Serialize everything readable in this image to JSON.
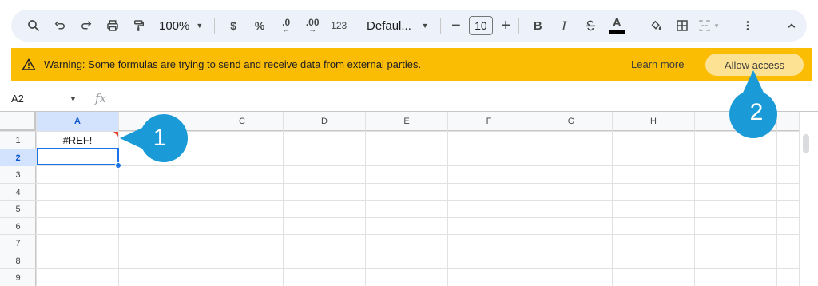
{
  "toolbar": {
    "zoom": "100%",
    "percent": "%",
    "currency": "$",
    "decrease_decimal": ".0",
    "increase_decimal": ".00",
    "number_format": "123",
    "font": "Defaul...",
    "font_size": "10",
    "minus": "−",
    "plus": "+",
    "bold": "B",
    "italic": "I",
    "text_color_letter": "A"
  },
  "warning": {
    "message": "Warning: Some formulas are trying to send and receive data from external parties.",
    "learn_more": "Learn more",
    "allow_access": "Allow access",
    "color": "#fbbc04"
  },
  "formula_bar": {
    "name_box": "A2",
    "fx_label": "fx"
  },
  "sheet": {
    "columns": [
      "A",
      "B",
      "C",
      "D",
      "E",
      "F",
      "G",
      "H"
    ],
    "rows": [
      "1",
      "2",
      "3",
      "4",
      "5",
      "6",
      "7",
      "8",
      "9"
    ],
    "selected_column": "A",
    "selected_row": "2",
    "cells": {
      "A1": "#REF!"
    }
  },
  "callouts": {
    "one": "1",
    "two": "2",
    "color": "#1a9bd7"
  }
}
